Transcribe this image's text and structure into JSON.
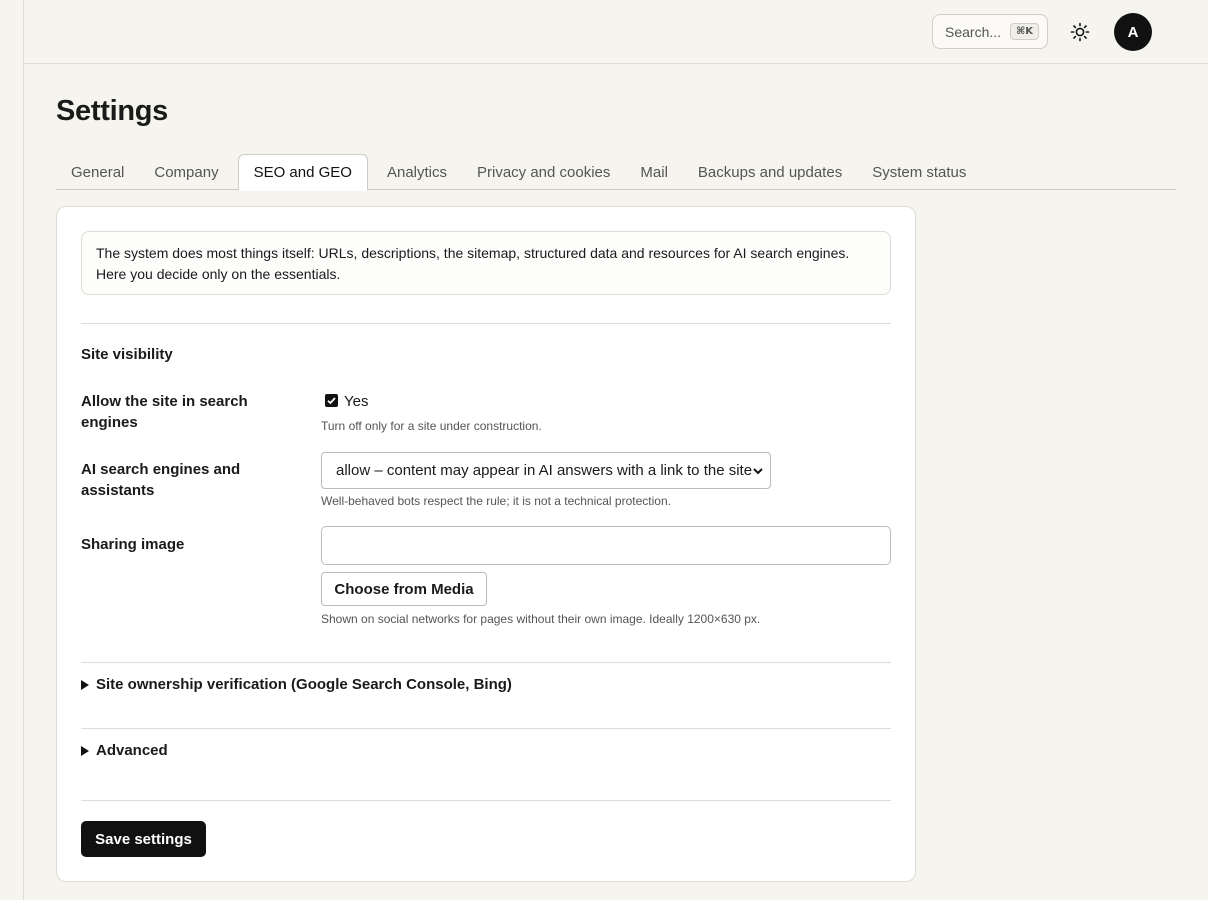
{
  "header": {
    "search_label": "Search...",
    "search_shortcut": "⌘K",
    "theme_icon": "sun-icon",
    "avatar_initial": "A"
  },
  "page": {
    "title": "Settings"
  },
  "tabs": [
    {
      "label": "General",
      "active": false
    },
    {
      "label": "Company",
      "active": false
    },
    {
      "label": "SEO and GEO",
      "active": true
    },
    {
      "label": "Analytics",
      "active": false
    },
    {
      "label": "Privacy and cookies",
      "active": false
    },
    {
      "label": "Mail",
      "active": false
    },
    {
      "label": "Backups and updates",
      "active": false
    },
    {
      "label": "System status",
      "active": false
    }
  ],
  "card": {
    "intro": "The system does most things itself: URLs, descriptions, the sitemap, structured data and resources for AI search engines. Here you decide only on the essentials.",
    "section_title": "Site visibility",
    "search_engines": {
      "label": "Allow the site in search engines",
      "checked": true,
      "option_label": "Yes",
      "help": "Turn off only for a site under construction."
    },
    "ai_engines": {
      "label": "AI search engines and assistants",
      "selected": "allow – content may appear in AI answers with a link to the site",
      "help": "Well-behaved bots respect the rule; it is not a technical protection."
    },
    "sharing_image": {
      "label": "Sharing image",
      "value": "",
      "button_label": "Choose from Media",
      "help": "Shown on social networks for pages without their own image. Ideally 1200×630 px."
    },
    "verification_summary": "Site ownership verification (Google Search Console, Bing)",
    "advanced_summary": "Advanced",
    "save_label": "Save settings"
  }
}
